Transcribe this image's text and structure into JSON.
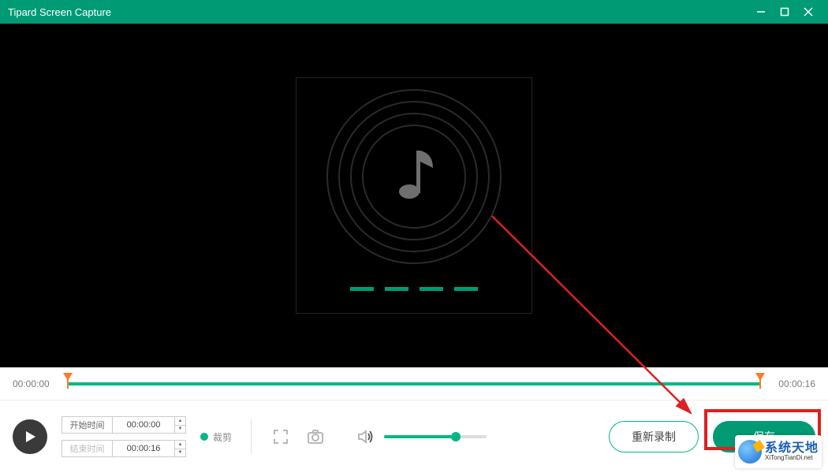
{
  "app": {
    "title": "Tipard Screen Capture"
  },
  "timeline": {
    "start": "00:00:00",
    "end": "00:00:16"
  },
  "inputs": {
    "start_label": "开始时间",
    "end_label": "结束时间",
    "start_value": "00:00:00",
    "end_value": "00:00:16",
    "crop_label": "裁剪"
  },
  "volume": {
    "percent": 70
  },
  "buttons": {
    "rerecord": "重新录制",
    "save": "保存"
  },
  "watermark": {
    "cn": "系统天地",
    "en": "XiTongTianDi.net"
  },
  "colors": {
    "accent": "#009b74",
    "accent_light": "#00b886",
    "annotation": "#e02020"
  }
}
